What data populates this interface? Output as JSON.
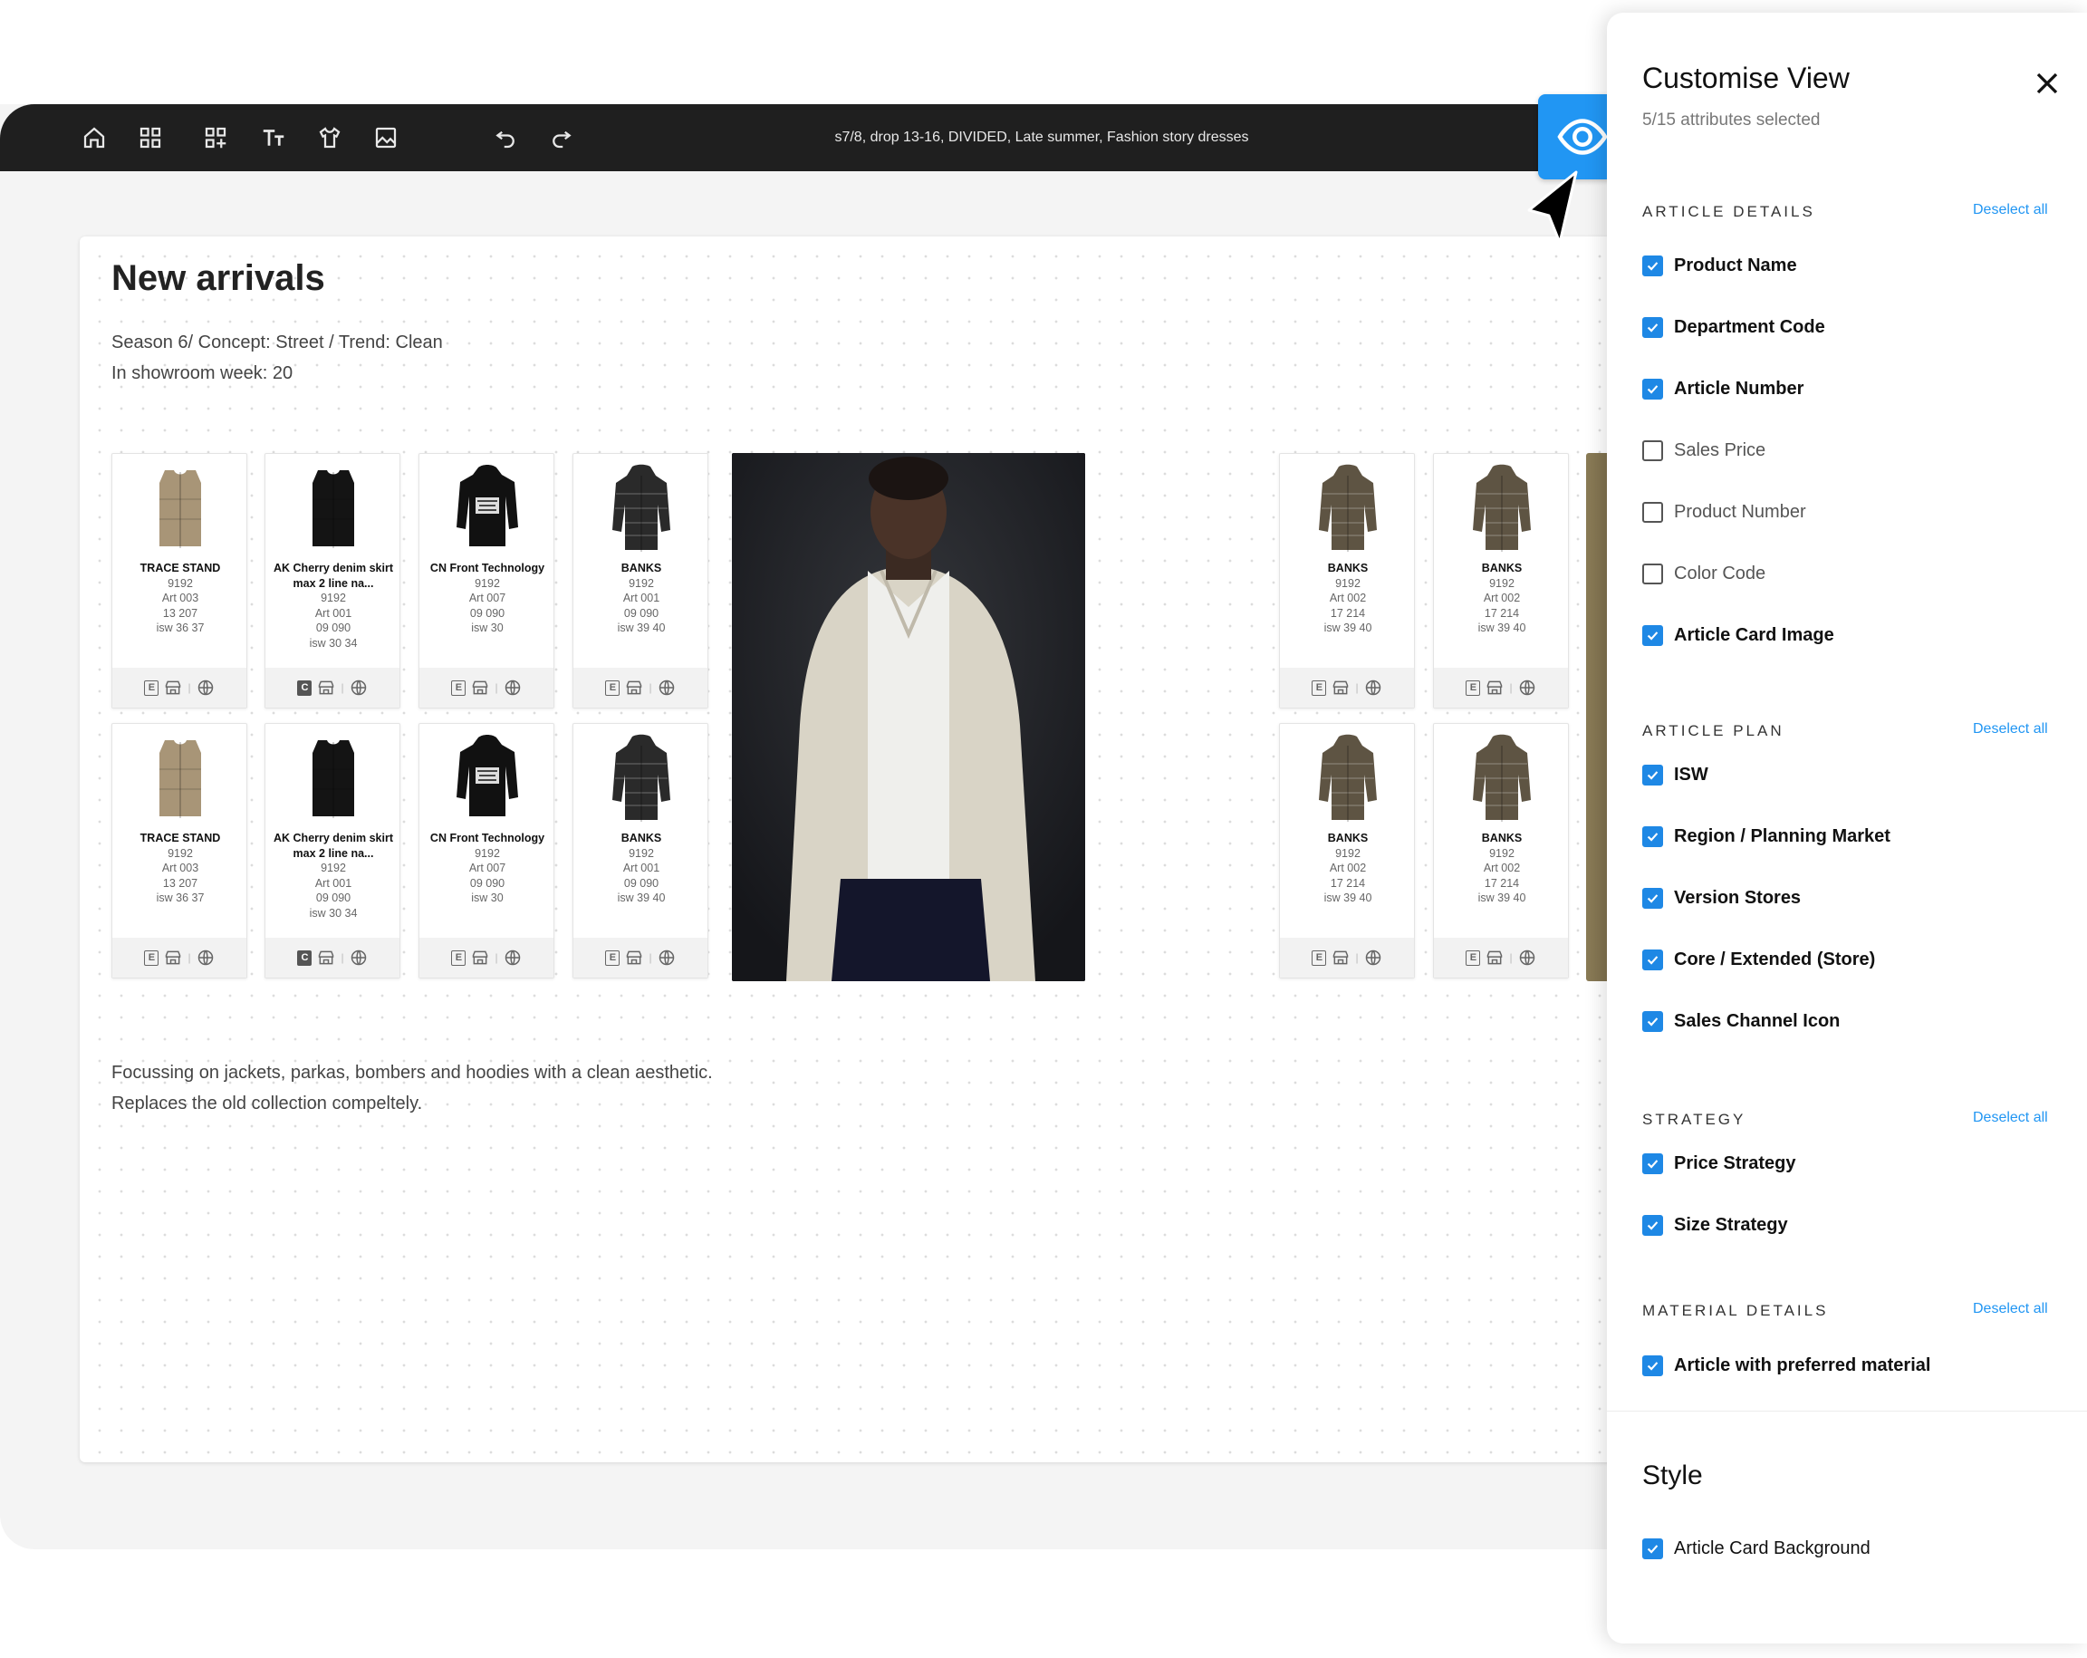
{
  "toolbar": {
    "title": "s7/8, drop 13-16, DIVIDED, Late summer, Fashion story dresses",
    "icons": [
      "home-icon",
      "grid-icon",
      "grid-add-icon",
      "text-size-icon",
      "garment-icon",
      "image-icon",
      "undo-icon",
      "redo-icon"
    ],
    "view_icon": "eye-icon"
  },
  "board": {
    "title": "New arrivals",
    "subtitle_line1": "Season 6/ Concept: Street / Trend: Clean",
    "subtitle_line2": "In showroom week: 20",
    "desc_line1": "Focussing on jackets, parkas, bombers and hoodies with a clean aesthetic.",
    "desc_line2": "Replaces the old collection compeltely."
  },
  "cards": [
    {
      "name": "TRACE STAND",
      "l1": "9192",
      "l2": "Art 003",
      "l3": "13 207",
      "l4": "isw 36 37",
      "badge": "E",
      "badge_dark": false,
      "garment": "vest",
      "color": "#a89577"
    },
    {
      "name": "AK Cherry denim skirt max 2 line na...",
      "l1": "9192",
      "l2": "Art 001",
      "l3": "09 090",
      "l4": "isw 30 34",
      "badge": "C",
      "badge_dark": true,
      "garment": "vest",
      "color": "#141414"
    },
    {
      "name": "CN Front Technology",
      "l1": "9192",
      "l2": "Art 007",
      "l3": "09 090",
      "l4": "isw 30",
      "badge": "E",
      "badge_dark": false,
      "garment": "hoodie",
      "color": "#111111"
    },
    {
      "name": "BANKS",
      "l1": "9192",
      "l2": "Art 001",
      "l3": "09 090",
      "l4": "isw 39 40",
      "badge": "E",
      "badge_dark": false,
      "garment": "puffer",
      "color": "#2a2a2a"
    },
    {
      "name": "BANKS",
      "l1": "9192",
      "l2": "Art 002",
      "l3": "17 214",
      "l4": "isw 39 40",
      "badge": "E",
      "badge_dark": false,
      "garment": "puffer",
      "color": "#5e5443"
    },
    {
      "name": "BANKS",
      "l1": "9192",
      "l2": "Art 002",
      "l3": "17 214",
      "l4": "isw 39 40",
      "badge": "E",
      "badge_dark": false,
      "garment": "puffer",
      "color": "#5e5443"
    }
  ],
  "panel": {
    "title": "Customise View",
    "subtitle": "5/15 attributes selected",
    "deselect_label": "Deselect all",
    "sections": [
      {
        "heading": "ARTICLE DETAILS",
        "options": [
          {
            "label": "Product Name",
            "checked": true
          },
          {
            "label": "Department Code",
            "checked": true
          },
          {
            "label": "Article Number",
            "checked": true
          },
          {
            "label": "Sales Price",
            "checked": false
          },
          {
            "label": "Product Number",
            "checked": false
          },
          {
            "label": "Color Code",
            "checked": false
          },
          {
            "label": "Article Card Image",
            "checked": true
          }
        ]
      },
      {
        "heading": "ARTICLE PLAN",
        "options": [
          {
            "label": "ISW",
            "checked": true
          },
          {
            "label": "Region / Planning Market",
            "checked": true
          },
          {
            "label": "Version Stores",
            "checked": true
          },
          {
            "label": "Core / Extended (Store)",
            "checked": true
          },
          {
            "label": "Sales Channel Icon",
            "checked": true
          }
        ]
      },
      {
        "heading": "STRATEGY",
        "options": [
          {
            "label": "Price Strategy",
            "checked": true
          },
          {
            "label": "Size Strategy",
            "checked": true
          }
        ]
      },
      {
        "heading": "MATERIAL DETAILS",
        "options": [
          {
            "label": "Article with preferred material",
            "checked": true
          }
        ]
      }
    ],
    "style_heading": "Style",
    "style_option": {
      "label": "Article Card Background",
      "checked": true
    }
  },
  "colors": {
    "accent": "#2196f3",
    "toolbar_bg": "#1f1f1f",
    "checkbox_on": "#1e88e5"
  }
}
